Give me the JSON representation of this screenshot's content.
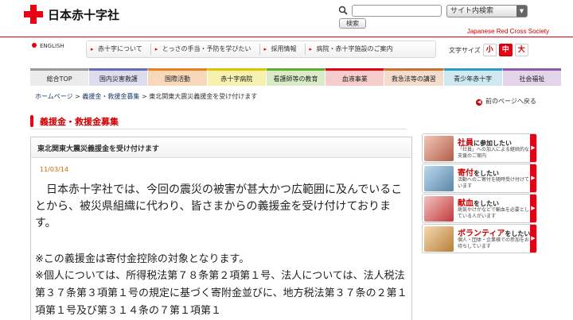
{
  "header": {
    "logo_text": "日本赤十字社",
    "search_button": "検索",
    "site_select": "サイト内検索",
    "tagline": "Japanese Red Cross Society",
    "english": "ENGLISH",
    "font_size_label": "文字サイズ",
    "font_sizes": [
      "小",
      "中",
      "大"
    ]
  },
  "subnav": [
    "赤十字について",
    "とっさの手当・予防を学びたい",
    "採用情報",
    "病院・赤十字施設のご案内"
  ],
  "gnav": [
    {
      "label": "総合TOP",
      "bg": "#ececec",
      "accent": "#999999"
    },
    {
      "label": "国内災害救護",
      "bg": "#dcdcef",
      "accent": "#6a6ab5"
    },
    {
      "label": "国際活動",
      "bg": "#f7d8b8",
      "accent": "#e8801e"
    },
    {
      "label": "赤十字病院",
      "bg": "#f6f1b0",
      "accent": "#d9c600"
    },
    {
      "label": "看護師等の教育",
      "bg": "#d9ecc7",
      "accent": "#5fae2e"
    },
    {
      "label": "血液事業",
      "bg": "#f7cccc",
      "accent": "#e60012"
    },
    {
      "label": "救急法等の講習",
      "bg": "#f3dccc",
      "accent": "#c9702f"
    },
    {
      "label": "青少年赤十字",
      "bg": "#cfe8f2",
      "accent": "#2b9bc8"
    },
    {
      "label": "社会福祉",
      "bg": "#e3d4ea",
      "accent": "#8d5aa8"
    }
  ],
  "breadcrumb": {
    "items": [
      "ホームページ",
      "義援金・救援金募集",
      "東北関東大震災義援金を受け付けます"
    ],
    "sep": " > "
  },
  "back_link": "前のページへ戻る",
  "page_title": "義援金・救援金募集",
  "article": {
    "heading": "東北関東大震災義援金を受け付けます",
    "date": "11/03/14",
    "body": "日本赤十字社では、今回の震災の被害が甚大かつ広範囲に及んでいることから、被災県組織に代わり、皆さまからの義援金を受け付けております。",
    "note1": "※この義援金は寄付金控除の対象となります。",
    "note2": "※個人については、所得税法第７８条第２項第１号、法人については、法人税法第３７条第３項第１号の規定に基づく寄附金並びに、地方税法第３７条の２第１項第１号及び第３１４条の７第１項第１"
  },
  "banners": [
    {
      "title": "社員",
      "title2": "に参加したい",
      "sub": "「社員」への加入による継続的な支援のご案内"
    },
    {
      "title": "寄付",
      "title2": "をしたい",
      "sub": "活動へのご寄付を随時受け付けています"
    },
    {
      "title": "献血",
      "title2": "をしたい",
      "sub": "病気やけがなどで輸血を必要としている人がいます"
    },
    {
      "title": "ボランティア",
      "title2": "をしたい",
      "sub": "個人・団体・企業様での参加をお待ちしています"
    }
  ]
}
